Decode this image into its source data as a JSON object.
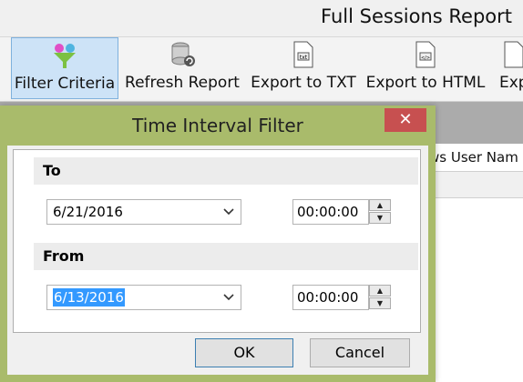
{
  "app": {
    "title": "Full Sessions Report",
    "toolbar": [
      {
        "label": "Filter Criteria",
        "icon": "filter-icon",
        "active": true
      },
      {
        "label": "Refresh Report",
        "icon": "database-refresh-icon"
      },
      {
        "label": "Export to TXT",
        "icon": "txt-document-icon"
      },
      {
        "label": "Export to HTML",
        "icon": "html-document-icon"
      },
      {
        "label": "Exp",
        "icon": "export-icon"
      }
    ],
    "grid_header_partial": "ws User Nam"
  },
  "dialog": {
    "title": "Time Interval Filter",
    "close_glyph": "✕",
    "to": {
      "label": "To",
      "date": "6/21/2016",
      "time": "00:00:00"
    },
    "from": {
      "label": "From",
      "date": "6/13/2016",
      "time": "00:00:00"
    },
    "ok_label": "OK",
    "cancel_label": "Cancel"
  },
  "colors": {
    "dialog_frame": "#a9bb6b",
    "close_button": "#c75050",
    "selection": "#3399ff",
    "active_tool": "#cde3f7"
  }
}
